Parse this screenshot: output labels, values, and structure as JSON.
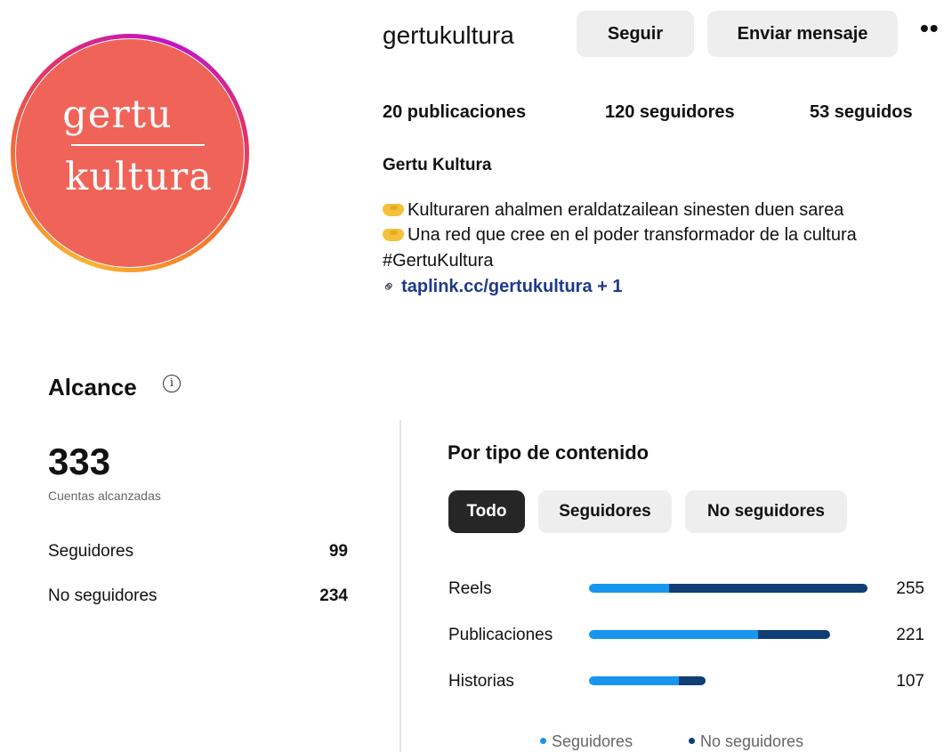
{
  "profile": {
    "logo": {
      "top": "gertu",
      "bottom": "kultura"
    },
    "username": "gertukultura",
    "follow_label": "Seguir",
    "message_label": "Enviar mensaje",
    "more_label": "••",
    "stats": {
      "posts": "20 publicaciones",
      "followers": "120 seguidores",
      "following": "53 seguidos"
    },
    "full_name": "Gertu Kultura",
    "bio": [
      "Kulturaren ahalmen eraldatzailean sinesten duen sarea",
      "Una red que cree en el poder transformador de la cultura",
      "#GertuKultura"
    ],
    "link": "taplink.cc/gertukultura + 1",
    "avatar_color": "#f06359"
  },
  "reach": {
    "title": "Alcance",
    "total": "333",
    "total_caption": "Cuentas alcanzadas",
    "rows": [
      {
        "label": "Seguidores",
        "value": "99"
      },
      {
        "label": "No seguidores",
        "value": "234"
      }
    ]
  },
  "content_type": {
    "title": "Por tipo de contenido",
    "tabs": [
      "Todo",
      "Seguidores",
      "No seguidores"
    ],
    "active_tab": "Todo",
    "colors": {
      "followers": "#1796f0",
      "non_followers": "#0f3f73"
    },
    "legend": [
      "Seguidores",
      "No seguidores"
    ]
  },
  "chart_data": {
    "type": "bar",
    "orientation": "horizontal",
    "stacked": true,
    "categories": [
      "Reels",
      "Publicaciones",
      "Historias"
    ],
    "totals": [
      "255",
      "221",
      "107"
    ],
    "series": [
      {
        "name": "Seguidores",
        "values": [
          73,
          155,
          82
        ]
      },
      {
        "name": "No seguidores",
        "values": [
          182,
          66,
          25
        ]
      }
    ],
    "xlim": [
      0,
      255
    ]
  }
}
